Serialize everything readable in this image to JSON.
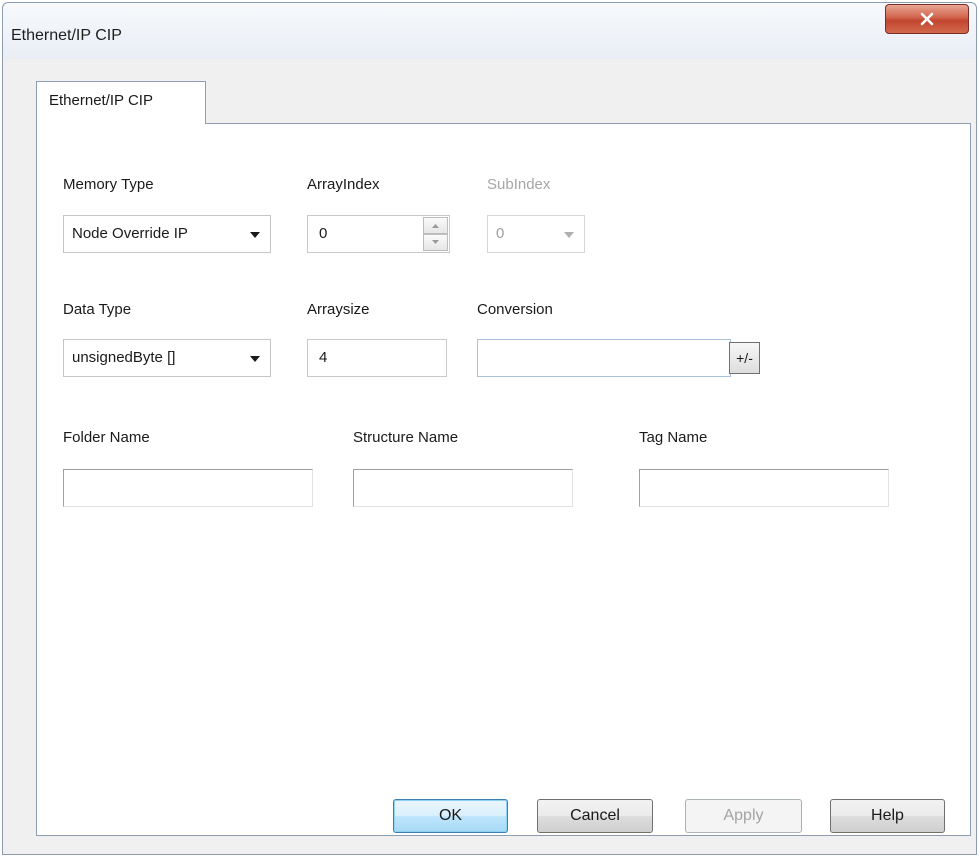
{
  "window": {
    "title": "Ethernet/IP CIP",
    "close_icon": "close-icon"
  },
  "tab": {
    "label": "Ethernet/IP CIP"
  },
  "memory_type": {
    "label": "Memory Type",
    "value": "Node Override IP"
  },
  "array_index": {
    "label": "ArrayIndex",
    "value": "0"
  },
  "sub_index": {
    "label": "SubIndex",
    "value": "0"
  },
  "data_type": {
    "label": "Data Type",
    "value": "unsignedByte []"
  },
  "array_size": {
    "label": "Arraysize",
    "value": "4"
  },
  "conversion": {
    "label": "Conversion",
    "value": "",
    "toggle_label": "+/-"
  },
  "folder_name": {
    "label": "Folder Name",
    "value": ""
  },
  "structure_name": {
    "label": "Structure Name",
    "value": ""
  },
  "tag_name": {
    "label": "Tag Name",
    "value": ""
  },
  "buttons": {
    "ok": "OK",
    "cancel": "Cancel",
    "apply": "Apply",
    "help": "Help"
  },
  "colors": {
    "close_button": "#c1462f",
    "default_button_border": "#3c7fb1"
  }
}
